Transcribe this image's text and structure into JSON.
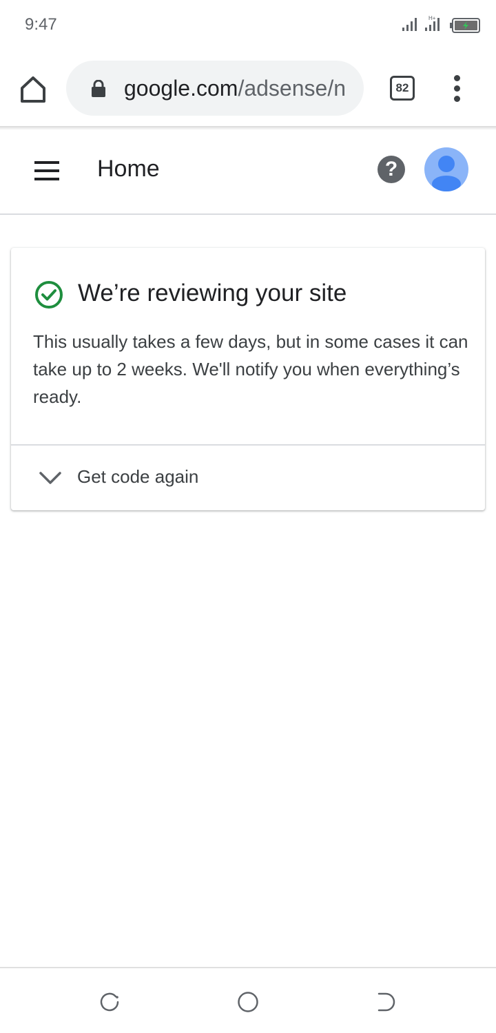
{
  "status_bar": {
    "time": "9:47"
  },
  "browser": {
    "url_host": "google.com",
    "url_path": "/adsense/n",
    "tab_count": "82",
    "icons": [
      "home-icon",
      "lock-icon",
      "tab-switcher-icon",
      "more-vert-icon"
    ]
  },
  "appbar": {
    "title": "Home",
    "help_label": "?",
    "icons": [
      "menu-icon",
      "help-icon",
      "account-avatar"
    ]
  },
  "card": {
    "title": "We’re reviewing your site",
    "body": "This usually takes a few days, but in some cases it can take up to 2 weeks. We'll notify you when everything’s ready.",
    "expand_label": "Get code again",
    "status_color": "#1e8e3e"
  },
  "colors": {
    "accent_green": "#1e8e3e",
    "avatar_bg": "#8ab4f8",
    "avatar_fg": "#4285f4",
    "text_primary": "#202124",
    "text_secondary": "#3c4043"
  }
}
